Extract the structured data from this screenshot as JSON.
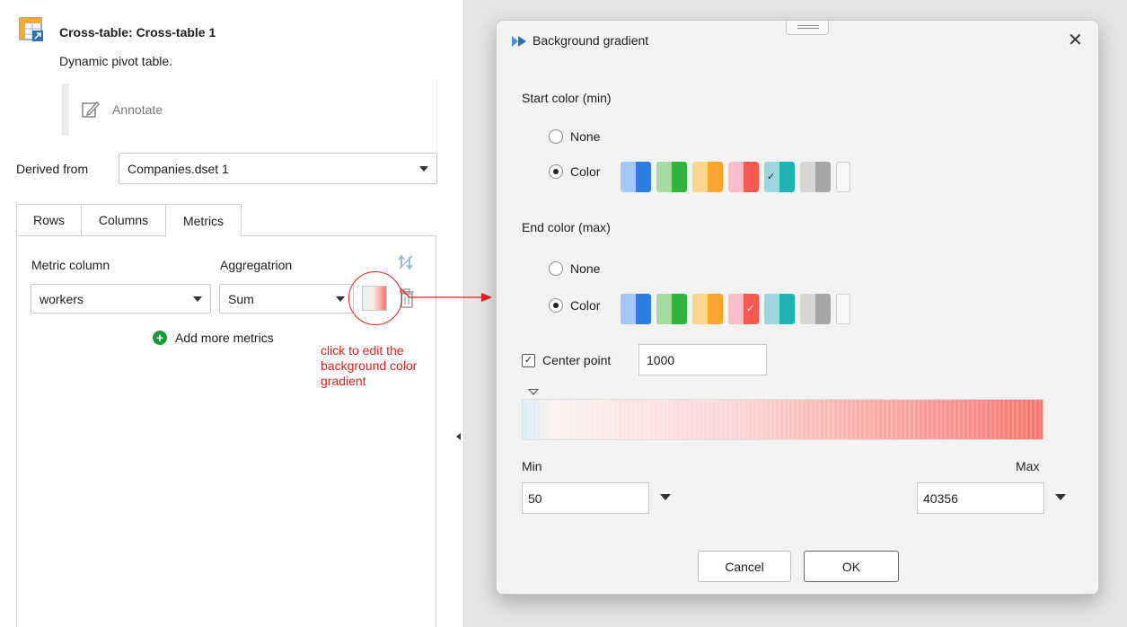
{
  "node": {
    "title": "Cross-table: Cross-table 1",
    "subtitle": "Dynamic pivot table."
  },
  "annotate_label": "Annotate",
  "derived": {
    "label": "Derived from",
    "value": "Companies.dset 1"
  },
  "tabs": [
    {
      "label": "Rows",
      "active": false
    },
    {
      "label": "Columns",
      "active": false
    },
    {
      "label": "Metrics",
      "active": true
    }
  ],
  "metrics": {
    "metric_column_label": "Metric column",
    "aggregation_label": "Aggregatrion",
    "metric_value": "workers",
    "aggregation_value": "Sum",
    "add_more_label": "Add more metrics"
  },
  "annotation_text": "click to edit the background color gradient",
  "dialog": {
    "title": "Background gradient",
    "close_glyph": "✕",
    "start_label": "Start color (min)",
    "end_label": "End color (max)",
    "none_label": "None",
    "color_label": "Color",
    "start_selected_swatch": "teal-light",
    "end_selected_swatch": "red-dark",
    "swatches": [
      {
        "id": "blue-light",
        "color": "#a3c8f5"
      },
      {
        "id": "blue-dark",
        "color": "#2f7de1"
      },
      {
        "id": "green-light",
        "color": "#a5dba0"
      },
      {
        "id": "green-dark",
        "color": "#2fb539"
      },
      {
        "id": "orange-light",
        "color": "#fcd68a"
      },
      {
        "id": "orange-dark",
        "color": "#f7a72c"
      },
      {
        "id": "red-light",
        "color": "#fbbcc8"
      },
      {
        "id": "red-dark",
        "color": "#f5594f"
      },
      {
        "id": "teal-light",
        "color": "#9dd6de"
      },
      {
        "id": "teal-dark",
        "color": "#20b3b3"
      },
      {
        "id": "gray-light",
        "color": "#d6d6d6"
      },
      {
        "id": "gray-dark",
        "color": "#a6a6a6"
      }
    ],
    "center_label": "Center point",
    "center_checked": true,
    "center_value": "1000",
    "min_label": "Min",
    "max_label": "Max",
    "min_value": "50",
    "max_value": "40356",
    "cancel_label": "Cancel",
    "ok_label": "OK"
  },
  "colors": {
    "accent_red": "#e02020",
    "add_green": "#1a9a3a",
    "gradient_start": "#d9edf2",
    "gradient_end": "#f8746c"
  }
}
